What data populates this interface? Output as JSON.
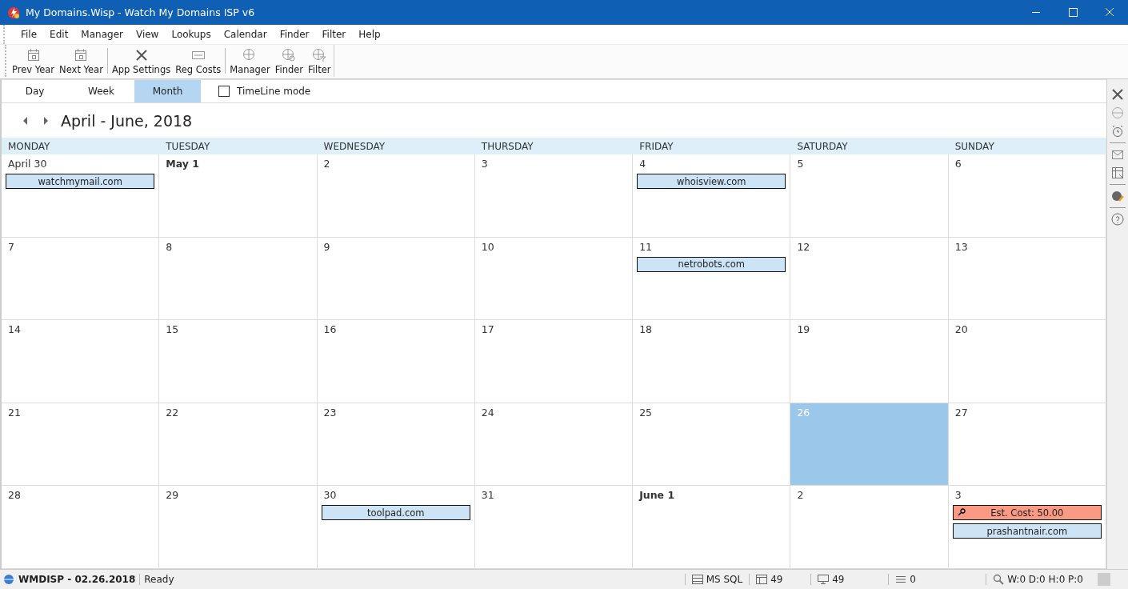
{
  "window": {
    "title": "My Domains.Wisp - Watch My Domains ISP v6"
  },
  "menu": [
    "File",
    "Edit",
    "Manager",
    "View",
    "Lookups",
    "Calendar",
    "Finder",
    "Filter",
    "Help"
  ],
  "toolbar": [
    "Prev Year",
    "Next Year",
    "App Settings",
    "Reg Costs",
    "Manager",
    "Finder",
    "Filter"
  ],
  "view_tabs": [
    {
      "label": "Day",
      "selected": false
    },
    {
      "label": "Week",
      "selected": false
    },
    {
      "label": "Month",
      "selected": true
    }
  ],
  "timeline_mode": {
    "label": "TimeLine mode",
    "checked": false
  },
  "calendar": {
    "title": "April - June, 2018",
    "weekdays": [
      "MONDAY",
      "TUESDAY",
      "WEDNESDAY",
      "THURSDAY",
      "FRIDAY",
      "SATURDAY",
      "SUNDAY"
    ],
    "weeks": [
      [
        {
          "day": "April 30",
          "bold": false,
          "selected": false,
          "events": [
            {
              "kind": "domain",
              "text": "watchmymail.com"
            }
          ]
        },
        {
          "day": "May 1",
          "bold": true,
          "selected": false
        },
        {
          "day": "2",
          "bold": false,
          "selected": false
        },
        {
          "day": "3",
          "bold": false,
          "selected": false
        },
        {
          "day": "4",
          "bold": false,
          "selected": false,
          "events": [
            {
              "kind": "domain",
              "text": "whoisview.com"
            }
          ]
        },
        {
          "day": "5",
          "bold": false,
          "selected": false
        },
        {
          "day": "6",
          "bold": false,
          "selected": false
        }
      ],
      [
        {
          "day": "7",
          "bold": false,
          "selected": false
        },
        {
          "day": "8",
          "bold": false,
          "selected": false
        },
        {
          "day": "9",
          "bold": false,
          "selected": false
        },
        {
          "day": "10",
          "bold": false,
          "selected": false
        },
        {
          "day": "11",
          "bold": false,
          "selected": false,
          "events": [
            {
              "kind": "domain",
              "text": "netrobots.com"
            }
          ]
        },
        {
          "day": "12",
          "bold": false,
          "selected": false
        },
        {
          "day": "13",
          "bold": false,
          "selected": false
        }
      ],
      [
        {
          "day": "14",
          "bold": false,
          "selected": false
        },
        {
          "day": "15",
          "bold": false,
          "selected": false
        },
        {
          "day": "16",
          "bold": false,
          "selected": false
        },
        {
          "day": "17",
          "bold": false,
          "selected": false
        },
        {
          "day": "18",
          "bold": false,
          "selected": false
        },
        {
          "day": "19",
          "bold": false,
          "selected": false
        },
        {
          "day": "20",
          "bold": false,
          "selected": false
        }
      ],
      [
        {
          "day": "21",
          "bold": false,
          "selected": false
        },
        {
          "day": "22",
          "bold": false,
          "selected": false
        },
        {
          "day": "23",
          "bold": false,
          "selected": false
        },
        {
          "day": "24",
          "bold": false,
          "selected": false
        },
        {
          "day": "25",
          "bold": false,
          "selected": false
        },
        {
          "day": "26",
          "bold": false,
          "selected": true
        },
        {
          "day": "27",
          "bold": false,
          "selected": false
        }
      ],
      [
        {
          "day": "28",
          "bold": false,
          "selected": false
        },
        {
          "day": "29",
          "bold": false,
          "selected": false
        },
        {
          "day": "30",
          "bold": false,
          "selected": false,
          "events": [
            {
              "kind": "domain",
              "text": "toolpad.com"
            }
          ]
        },
        {
          "day": "31",
          "bold": false,
          "selected": false
        },
        {
          "day": "June 1",
          "bold": true,
          "selected": false
        },
        {
          "day": "2",
          "bold": false,
          "selected": false
        },
        {
          "day": "3",
          "bold": false,
          "selected": false,
          "events": [
            {
              "kind": "cost",
              "text": "Est. Cost: 50.00"
            },
            {
              "kind": "domain",
              "text": "prashantnair.com"
            }
          ]
        }
      ]
    ]
  },
  "status_bar": {
    "title": "WMDISP - 02.26.2018",
    "state": "Ready",
    "database": "MS SQL",
    "windows": "49",
    "computers": "49",
    "list": "0",
    "counts": "W:0 D:0 H:0 P:0"
  }
}
